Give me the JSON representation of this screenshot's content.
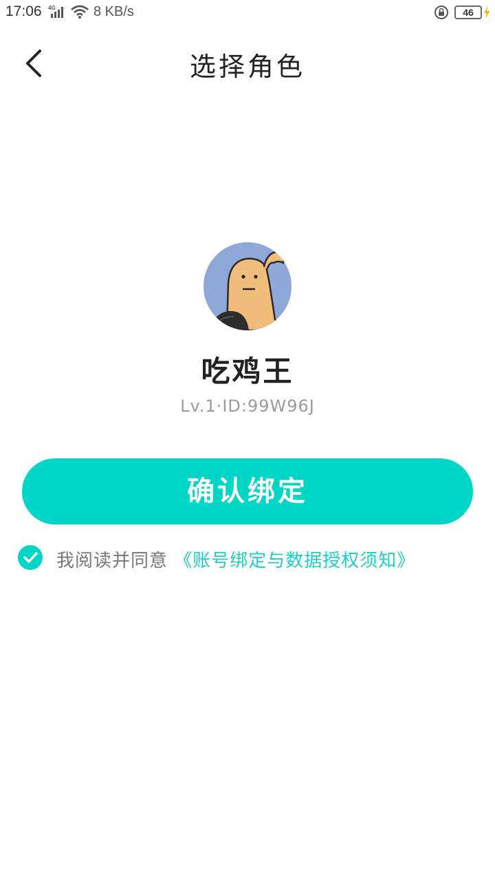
{
  "status_bar": {
    "time": "17:06",
    "network_label": "4G",
    "speed": "8 KB/s",
    "battery": "46"
  },
  "header": {
    "title": "选择角色"
  },
  "role": {
    "name": "吃鸡王",
    "meta": "Lv.1·ID:99W96J"
  },
  "actions": {
    "confirm_label": "确认绑定"
  },
  "agreement": {
    "checked": true,
    "prefix": "我阅读并同意",
    "link_text": "《账号绑定与数据授权须知》"
  },
  "colors": {
    "accent": "#00d6c5",
    "link": "#1ccfc2",
    "avatar_bg": "#8fa8d8"
  }
}
